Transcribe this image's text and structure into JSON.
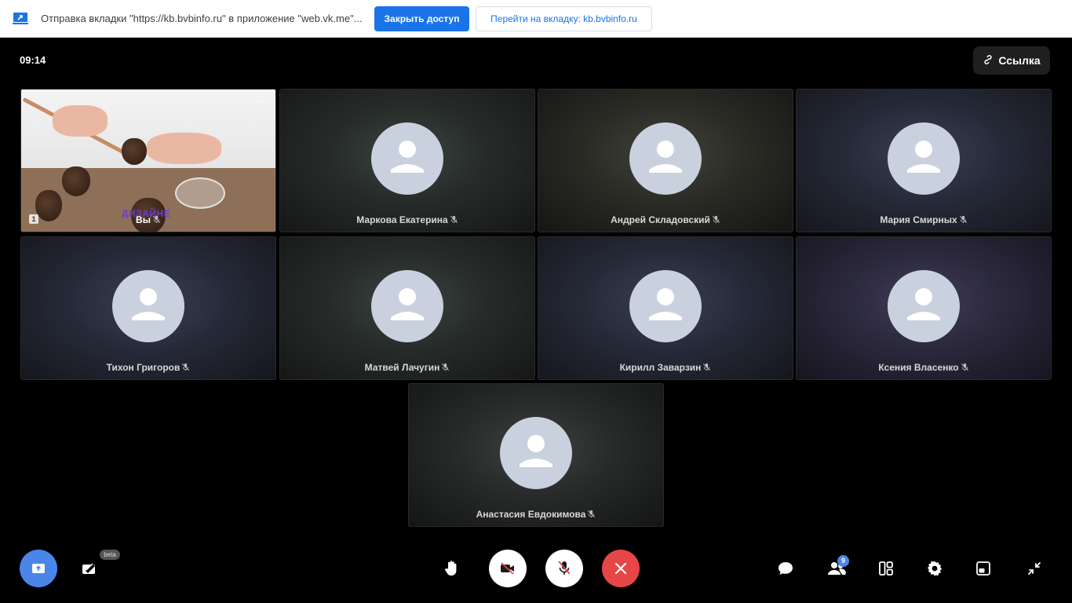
{
  "share_banner": {
    "text": "Отправка вкладки \"https://kb.bvbinfo.ru\" в приложение \"web.vk.me\"...",
    "stop_label": "Закрыть доступ",
    "goto_label": "Перейти на вкладку: kb.bvbinfo.ru"
  },
  "header": {
    "time": "09:14",
    "link_label": "Ссылка"
  },
  "self_tile": {
    "name": "Вы",
    "watermark": "ДИЗАЙНЕ",
    "corner_badge": "1",
    "corner_icon": "pip-icon"
  },
  "participants": [
    {
      "name": "Маркова Екатерина",
      "muted": true
    },
    {
      "name": "Андрей Складовский",
      "muted": true
    },
    {
      "name": "Мария Смирных",
      "muted": true
    },
    {
      "name": "Тихон Григоров",
      "muted": true
    },
    {
      "name": "Матвей Лачугин",
      "muted": true
    },
    {
      "name": "Кирилл Заварзин",
      "muted": true
    },
    {
      "name": "Ксения Власенко",
      "muted": true
    },
    {
      "name": "Анастасия Евдокимова",
      "muted": true
    }
  ],
  "toolbar": {
    "beta_label": "beta",
    "participants_count": "9",
    "colors": {
      "share": "#4a86e8",
      "end_call": "#e64646",
      "controls": "#ffffff"
    }
  }
}
